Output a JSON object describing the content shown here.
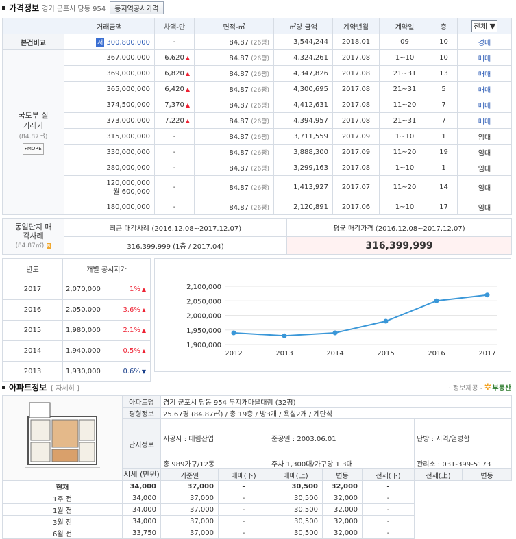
{
  "price": {
    "section_title": "가격정보",
    "address": "경기 군포시 당동 954",
    "button": "동지역공시가격",
    "headers": [
      "거래금액",
      "차액-만",
      "면적-㎡",
      "㎡당 금액",
      "계약년월",
      "계약일",
      "층"
    ],
    "filter": "전체",
    "compare": {
      "label": "본건비교",
      "badge": "저",
      "amount": "300,800,000",
      "diff": "-",
      "area": "84.87",
      "py": "(26평)",
      "per": "3,544,244",
      "ym": "2018.01",
      "day": "09",
      "floor": "10",
      "type": "경매"
    },
    "molit_label": "국토부 실거래가",
    "molit_area": "(84.87㎡)",
    "more": "MORE",
    "rows": [
      {
        "amount": "367,000,000",
        "diff": "6,620",
        "dir": "up",
        "area": "84.87",
        "py": "(26평)",
        "per": "4,324,261",
        "ym": "2017.08",
        "day": "1~10",
        "floor": "10",
        "type": "매매"
      },
      {
        "amount": "369,000,000",
        "diff": "6,820",
        "dir": "up",
        "area": "84.87",
        "py": "(26평)",
        "per": "4,347,826",
        "ym": "2017.08",
        "day": "21~31",
        "floor": "13",
        "type": "매매"
      },
      {
        "amount": "365,000,000",
        "diff": "6,420",
        "dir": "up",
        "area": "84.87",
        "py": "(26평)",
        "per": "4,300,695",
        "ym": "2017.08",
        "day": "21~31",
        "floor": "5",
        "type": "매매"
      },
      {
        "amount": "374,500,000",
        "diff": "7,370",
        "dir": "up",
        "area": "84.87",
        "py": "(26평)",
        "per": "4,412,631",
        "ym": "2017.08",
        "day": "11~20",
        "floor": "7",
        "type": "매매"
      },
      {
        "amount": "373,000,000",
        "diff": "7,220",
        "dir": "up",
        "area": "84.87",
        "py": "(26평)",
        "per": "4,394,957",
        "ym": "2017.08",
        "day": "21~31",
        "floor": "7",
        "type": "매매"
      },
      {
        "amount": "315,000,000",
        "diff": "-",
        "dir": "",
        "area": "84.87",
        "py": "(26평)",
        "per": "3,711,559",
        "ym": "2017.09",
        "day": "1~10",
        "floor": "1",
        "type": "임대"
      },
      {
        "amount": "330,000,000",
        "diff": "-",
        "dir": "",
        "area": "84.87",
        "py": "(26평)",
        "per": "3,888,300",
        "ym": "2017.09",
        "day": "11~20",
        "floor": "19",
        "type": "임대"
      },
      {
        "amount": "280,000,000",
        "diff": "-",
        "dir": "",
        "area": "84.87",
        "py": "(26평)",
        "per": "3,299,163",
        "ym": "2017.08",
        "day": "1~10",
        "floor": "1",
        "type": "임대"
      },
      {
        "amount": "120,000,000",
        "amount2": "월 600,000",
        "diff": "-",
        "dir": "",
        "area": "84.87",
        "py": "(26평)",
        "per": "1,413,927",
        "ym": "2017.07",
        "day": "11~20",
        "floor": "14",
        "type": "임대"
      },
      {
        "amount": "180,000,000",
        "diff": "-",
        "dir": "",
        "area": "84.87",
        "py": "(26평)",
        "per": "2,120,891",
        "ym": "2017.06",
        "day": "1~10",
        "floor": "17",
        "type": "임대"
      }
    ]
  },
  "same": {
    "label": "동일단지 매각사례",
    "area": "(84.87㎡)",
    "recent_hdr": "최근 매각사례 (2016.12.08~2017.12.07)",
    "avg_hdr": "평균 매각가격 (2016.12.08~2017.12.07)",
    "recent": "316,399,999 (1층 / 2017.04)",
    "avg": "316,399,999"
  },
  "gong": {
    "hdr_year": "년도",
    "hdr_price": "개별 공시지가",
    "rows": [
      {
        "year": "2017",
        "price": "2,070,000",
        "pct": "1%",
        "dir": "up"
      },
      {
        "year": "2016",
        "price": "2,050,000",
        "pct": "3.6%",
        "dir": "up"
      },
      {
        "year": "2015",
        "price": "1,980,000",
        "pct": "2.1%",
        "dir": "up"
      },
      {
        "year": "2014",
        "price": "1,940,000",
        "pct": "0.5%",
        "dir": "up"
      },
      {
        "year": "2013",
        "price": "1,930,000",
        "pct": "0.6%",
        "dir": "dn"
      }
    ]
  },
  "chart_data": {
    "type": "line",
    "x": [
      "2012",
      "2013",
      "2014",
      "2015",
      "2016",
      "2017"
    ],
    "values": [
      1940000,
      1930000,
      1940000,
      1980000,
      2050000,
      2070000
    ],
    "ylim": [
      1900000,
      2100000
    ],
    "yticks": [
      "2,100,000",
      "2,050,000",
      "2,000,000",
      "1,950,000",
      "1,900,000"
    ],
    "color": "#3a97d8",
    "grid": true
  },
  "apt": {
    "section_title": "아파트정보",
    "detail_link": "[ 자세히 ]",
    "provider": "· 정보제공 -",
    "provider_logo": "부동산",
    "name_lbl": "아파트명",
    "name": "경기 군포시 당동 954 무지개마을대림 (32평)",
    "size_lbl": "평형정보",
    "size": "25.67평 (84.87㎡) / 총 19층 / 방3개 / 욕실2개 / 계단식",
    "complex_lbl": "단지정보",
    "builder": "시공사 : 대림산업",
    "done": "준공일 : 2003.06.01",
    "heat": "난방 : 지역/열병합",
    "households": "총 989가구/12동",
    "parking": "주차 1,300대/가구당 1.3대",
    "office": "관리소 : 031-399-5173",
    "market_lbl": "시세 (만원)",
    "market_hdr": [
      "기준일",
      "매매(下)",
      "매매(上)",
      "변동",
      "전세(下)",
      "전세(上)",
      "변동"
    ],
    "market_rows": [
      [
        "현재",
        "34,000",
        "37,000",
        "-",
        "30,500",
        "32,000",
        "-"
      ],
      [
        "1주 전",
        "34,000",
        "37,000",
        "-",
        "30,500",
        "32,000",
        "-"
      ],
      [
        "1월 전",
        "34,000",
        "37,000",
        "-",
        "30,500",
        "32,000",
        "-"
      ],
      [
        "3월 전",
        "34,000",
        "37,000",
        "-",
        "30,500",
        "32,000",
        "-"
      ],
      [
        "6월 전",
        "33,750",
        "37,000",
        "-",
        "30,500",
        "32,000",
        "-"
      ]
    ]
  }
}
